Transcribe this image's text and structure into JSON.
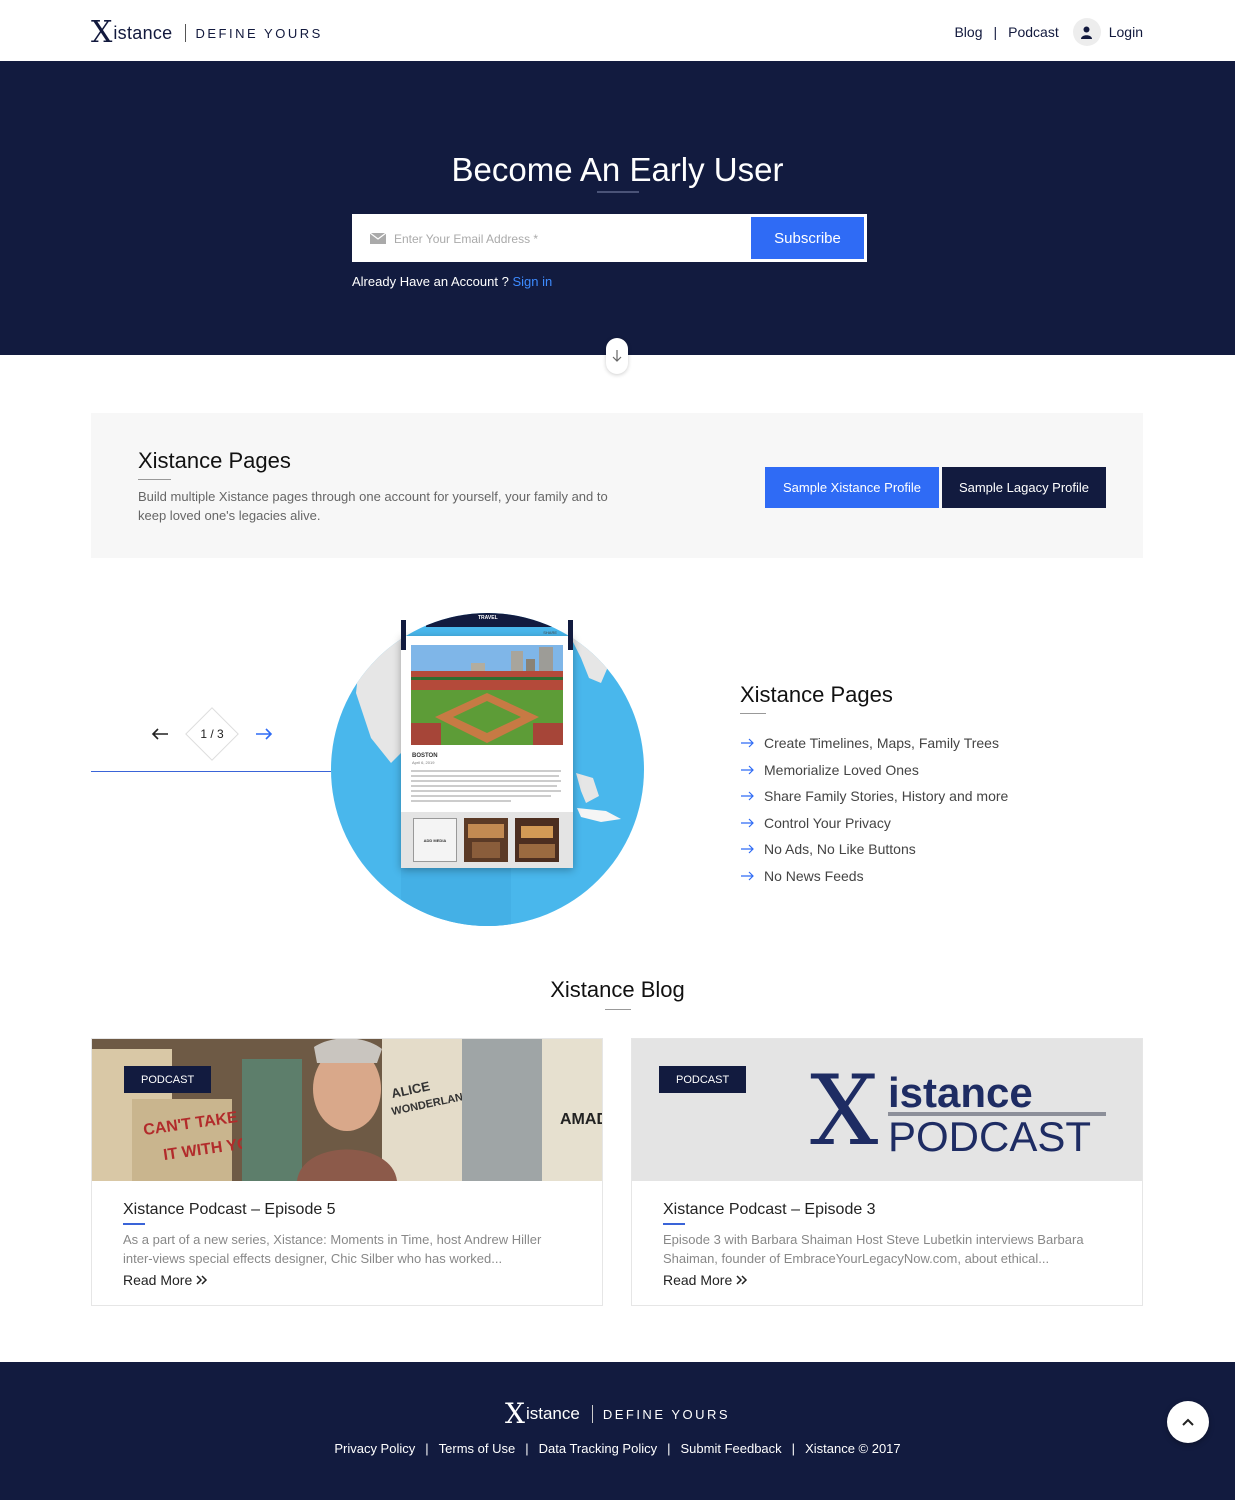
{
  "header": {
    "logo_x": "X",
    "logo_name": "istance",
    "logo_tagline": "DEFINE YOURS",
    "nav": {
      "blog": "Blog",
      "podcast": "Podcast",
      "login": "Login"
    }
  },
  "hero": {
    "title": "Become An Early User",
    "email_placeholder": "Enter Your Email Address *",
    "subscribe_label": "Subscribe",
    "already_text": "Already Have an Account ?",
    "sign_in_label": "Sign in"
  },
  "pages_box": {
    "title": "Xistance Pages",
    "description": "Build multiple Xistance pages through one account for yourself, your family and to keep loved one's legacies alive.",
    "sample_profile_label": "Sample Xistance Profile",
    "sample_legacy_label": "Sample Lagacy Profile"
  },
  "slider": {
    "counter": "1 / 3",
    "device": {
      "category": "TRAVEL",
      "share": "SHARE",
      "title": "BOSTON",
      "date": "April 6, 2019",
      "add_media": "ADD MEDIA"
    }
  },
  "features": {
    "title": "Xistance Pages",
    "items": [
      "Create Timelines, Maps, Family Trees",
      "Memorialize Loved Ones",
      "Share Family Stories, History and more",
      "Control Your Privacy",
      "No Ads, No Like Buttons",
      "No News Feeds"
    ]
  },
  "blog": {
    "title": "Xistance Blog",
    "cards": [
      {
        "badge": "PODCAST",
        "title": "Xistance Podcast – Episode 5",
        "excerpt": "As a part of a new series, Xistance: Moments in Time, host Andrew Hiller inter-views special effects designer, Chic Silber who has worked...",
        "read_more": "Read More"
      },
      {
        "badge": "PODCAST",
        "title": "Xistance Podcast – Episode 3",
        "excerpt": "Episode 3 with Barbara Shaiman Host Steve Lubetkin interviews Barbara Shaiman, founder of EmbraceYourLegacyNow.com, about ethical...",
        "read_more": "Read More",
        "image_logo": {
          "x": "X",
          "line1": "istance",
          "line2": "PODCAST"
        }
      }
    ]
  },
  "footer": {
    "logo_x": "X",
    "logo_name": "istance",
    "logo_tagline": "DEFINE YOURS",
    "links": [
      "Privacy Policy",
      "Terms of Use",
      "Data Tracking Policy",
      "Submit Feedback",
      "Xistance © 2017"
    ]
  },
  "colors": {
    "navy": "#121b3f",
    "blue": "#2f6bf5",
    "globe": "#49b7ec"
  }
}
